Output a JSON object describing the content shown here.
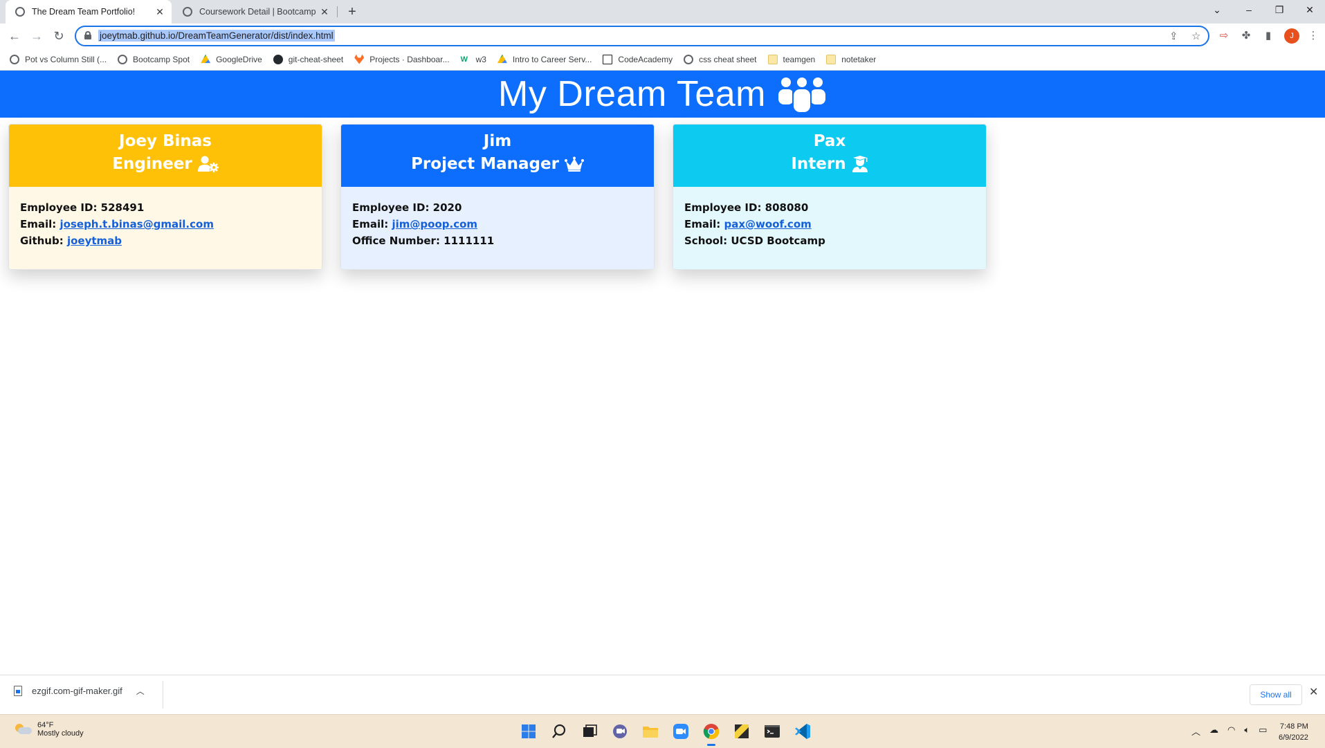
{
  "browser": {
    "tabs": [
      {
        "title": "The Dream Team Portfolio!",
        "active": true
      },
      {
        "title": "Coursework Detail | Bootcamp Sp",
        "active": false
      }
    ],
    "url": "joeytmab.github.io/DreamTeamGenerator/dist/index.html",
    "profile_initial": "J",
    "bookmarks": [
      {
        "label": "Pot vs Column Still (...",
        "icon": "globe-icon"
      },
      {
        "label": "Bootcamp Spot",
        "icon": "globe-icon"
      },
      {
        "label": "GoogleDrive",
        "icon": "drive-icon"
      },
      {
        "label": "git-cheat-sheet",
        "icon": "github-icon"
      },
      {
        "label": "Projects · Dashboar...",
        "icon": "gitlab-icon"
      },
      {
        "label": "w3",
        "icon": "w3-icon"
      },
      {
        "label": "Intro to Career Serv...",
        "icon": "drive-icon"
      },
      {
        "label": "CodeAcademy",
        "icon": "codecademy-icon"
      },
      {
        "label": "css cheat sheet",
        "icon": "globe-icon"
      },
      {
        "label": "teamgen",
        "icon": "folder-icon"
      },
      {
        "label": "notetaker",
        "icon": "folder-icon"
      }
    ]
  },
  "page": {
    "title": "My Dream Team",
    "colors": {
      "header": "#0d6efd",
      "engineer": "#ffc107",
      "manager": "#0d6efd",
      "intern": "#0dcaf0"
    }
  },
  "cards": {
    "engineer": {
      "name": "Joey Binas",
      "role": "Engineer",
      "role_icon": "user-gear-icon",
      "id_label": "Employee ID: ",
      "id": "528491",
      "email_label": "Email: ",
      "email": "joseph.t.binas@gmail.com",
      "extra_label": "Github: ",
      "extra": "joeytmab"
    },
    "manager": {
      "name": "Jim",
      "role": "Project Manager",
      "role_icon": "crown-icon",
      "id_label": "Employee ID: ",
      "id": "2020",
      "email_label": "Email: ",
      "email": "jim@poop.com",
      "extra_label": "Office Number: ",
      "extra": "1111111"
    },
    "intern": {
      "name": "Pax",
      "role": "Intern",
      "role_icon": "graduate-icon",
      "id_label": "Employee ID: ",
      "id": "808080",
      "email_label": "Email: ",
      "email": "pax@woof.com",
      "extra_label": "School: ",
      "extra": "UCSD Bootcamp"
    }
  },
  "downloads": {
    "file": "ezgif.com-gif-maker.gif",
    "show_all": "Show all"
  },
  "taskbar": {
    "temperature": "64°F",
    "weather": "Mostly cloudy",
    "time": "7:48 PM",
    "date": "6/9/2022"
  }
}
